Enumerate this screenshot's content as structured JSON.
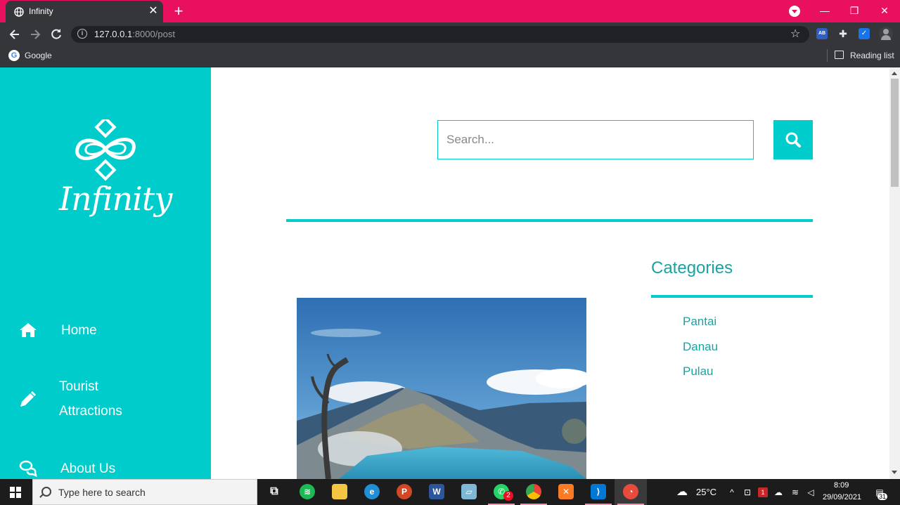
{
  "browser": {
    "tab_title": "Infinity",
    "new_tab_label": "+",
    "url_host": "127.0.0.1",
    "url_path": ":8000/post",
    "bookmarks": [
      {
        "label": "Google",
        "icon": "google-icon"
      }
    ],
    "reading_list_label": "Reading list",
    "extensions": [
      "adblock-icon",
      "puzzle-icon",
      "shield-icon"
    ],
    "accent_color": "#e8105f"
  },
  "sidebar": {
    "brand": "Infinity",
    "background": "#00cccc",
    "nav": [
      {
        "label": "Home",
        "icon": "home-icon"
      },
      {
        "label_line1": "Tourist",
        "label_line2": "Attractions",
        "icon": "pencil-icon"
      },
      {
        "label": "About Us",
        "icon": "chat-icon"
      }
    ]
  },
  "main": {
    "search": {
      "placeholder": "Search...",
      "value": "",
      "button_icon": "search-icon"
    },
    "post": {
      "image_description": "mountain crater lake"
    },
    "categories": {
      "title": "Categories",
      "items": [
        "Pantai",
        "Danau",
        "Pulau"
      ]
    }
  },
  "taskbar": {
    "search_placeholder": "Type here to search",
    "apps": [
      "task-view-icon",
      "spotify-icon",
      "file-explorer-icon",
      "edge-icon",
      "powerpoint-icon",
      "word-icon",
      "notes-icon",
      "whatsapp-icon",
      "chrome-icon",
      "xampp-icon",
      "vscode-icon",
      "app-icon"
    ],
    "whatsapp_badge": "2",
    "weather": "25°C",
    "time": "8:09",
    "date": "29/09/2021",
    "notifications": "31"
  }
}
